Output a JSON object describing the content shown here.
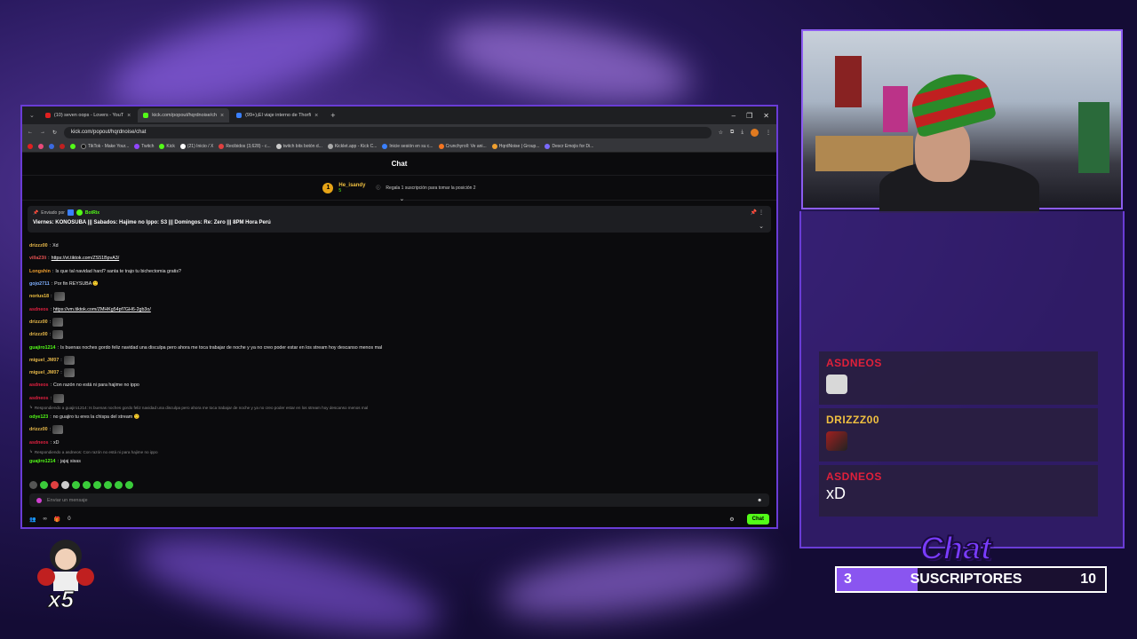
{
  "browser": {
    "tabs": [
      {
        "label": "(10) seven oops - Lovers - YouT",
        "color": "#e02020"
      },
      {
        "label": "kick.com/popout/hqrdnoise/ch",
        "color": "#53fc18",
        "active": true
      },
      {
        "label": "(99+)¡El viaje interno de Thorfi",
        "color": "#3a80ff"
      }
    ],
    "new_tab": "+",
    "url": "kick.com/popout/hqrdnoise/chat",
    "bookmarks": [
      "TikTok - Make Your...",
      "Twitch",
      "Kick",
      "(21) Inicio / X",
      "Recibidos (3,628) - c...",
      "twitch bits botón d...",
      "Kicklet.app - Kick C...",
      "Inicie sesión en su c...",
      "Crunchyroll: Ve ani...",
      "HqrdNoise | Group...",
      "Descr Emojis for Di..."
    ]
  },
  "chat": {
    "title": "Chat",
    "gifter": {
      "name": "He_isandy",
      "rank": "1",
      "count": "5",
      "cta": "Regala 1 suscripción para tomar la posición 2"
    },
    "pinned": {
      "sent_by_label": "Enviado por",
      "sender": "BotRix",
      "message": "Viernes: KONOSUBA ||| Sabados: Hajime no Ippo: S3 ||| Domingos: Re: Zero ||| 8PM Hora Perú"
    },
    "messages": [
      {
        "user": "drizzz00",
        "color": "#e8b94a",
        "text": "Xd"
      },
      {
        "user": "villa23li",
        "color": "#e05050",
        "text": "https://vt.tiktok.com/ZS51BpvA3/",
        "link": true
      },
      {
        "user": "Longshin",
        "color": "#f0a030",
        "text": "Is que tal navidad hard? santa te trajo tu bichectomia gratis?"
      },
      {
        "user": "gojo2711",
        "color": "#7fb0ff",
        "text": "Por fin REYSUBA 🙂"
      },
      {
        "user": "norius18",
        "color": "#f0c040",
        "text": "",
        "emote": true
      },
      {
        "user": "asdneos",
        "color": "#e02040",
        "text": "https://vm.tiktok.com/ZMHKg54pf7GH6-2gb3o/",
        "link": true
      },
      {
        "user": "drizzz00",
        "color": "#e8b94a",
        "text": "",
        "emote": true
      },
      {
        "user": "drizzz00",
        "color": "#e8b94a",
        "text": "",
        "emote": true
      },
      {
        "user": "guajiro1214",
        "color": "#53fc18",
        "text": "Is buenas noches gordo feliz navidad una disculpa pero ahora me toca trabajar de noche y ya no creo poder estar en los stream hoy descanso menos mal"
      },
      {
        "user": "miguel_JM07",
        "color": "#e8b94a",
        "text": "",
        "emote": true
      },
      {
        "user": "miguel_JM07",
        "color": "#e8b94a",
        "text": "",
        "emote": true
      },
      {
        "user": "asdneos",
        "color": "#e02040",
        "text": "Con razón no está ni para hajime no ippo"
      },
      {
        "user": "asdneos",
        "color": "#e02040",
        "text": "",
        "emote": true
      },
      {
        "reply": "Respondiendo a guajiro1214: Is buenas noches gordo feliz navidad una disculpa pero ahora me toca trabajar de noche y ya no creo poder estar en los stream hoy descanso menos mal"
      },
      {
        "user": "odye123",
        "color": "#53fc18",
        "text": "no guajiro tu eres la chispa del stream 🙂"
      },
      {
        "user": "drizzz00",
        "color": "#e8b94a",
        "text": "",
        "emote": true
      },
      {
        "user": "asdneos",
        "color": "#e02040",
        "text": "xD"
      },
      {
        "reply": "Respondiendo a asdneos: Con razón no está ni para hajime no ippo"
      },
      {
        "user": "guajiro1214",
        "color": "#53fc18",
        "text": "jajaj sisas"
      }
    ],
    "input_placeholder": "Enviar un mensaje",
    "viewers_count": "∞",
    "bottom_count": "0",
    "send_label": "Chat"
  },
  "overlay": {
    "messages": [
      {
        "user": "ASDNEOS",
        "color": "#e0203a",
        "text": "",
        "emote": true
      },
      {
        "user": "DRIZZZ00",
        "color": "#f0c040",
        "text": "",
        "emote": true
      },
      {
        "user": "ASDNEOS",
        "color": "#e0203a",
        "text": "xD"
      }
    ],
    "logo": "Chat",
    "sub_goal": {
      "current": "3",
      "label": "SUSCRIPTORES",
      "target": "10",
      "progress": 0.3
    },
    "mascot_multiplier": "x5"
  }
}
